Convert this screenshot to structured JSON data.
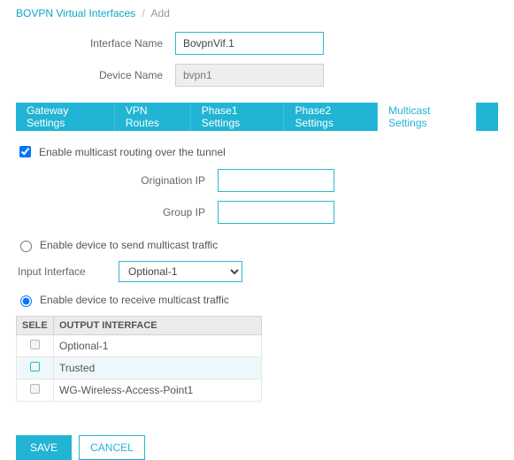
{
  "breadcrumb": {
    "root": "BOVPN Virtual Interfaces",
    "leaf": "Add"
  },
  "fields": {
    "interface_name_label": "Interface Name",
    "interface_name_value": "BovpnVif.1",
    "device_name_label": "Device Name",
    "device_name_value": "bvpn1"
  },
  "tabs": {
    "gateway": "Gateway Settings",
    "vpn_routes": "VPN Routes",
    "phase1": "Phase1 Settings",
    "phase2": "Phase2 Settings",
    "multicast": "Multicast Settings"
  },
  "multicast": {
    "enable_label": "Enable multicast routing over the tunnel",
    "enable_checked": true,
    "origination_ip_label": "Origination IP",
    "origination_ip_value": "",
    "group_ip_label": "Group IP",
    "group_ip_value": "",
    "send_label": "Enable device to send multicast traffic",
    "input_interface_label": "Input Interface",
    "input_interface_value": "Optional-1",
    "receive_label": "Enable device to receive multicast traffic",
    "table_headers": {
      "select": "SELE",
      "output": "OUTPUT INTERFACE"
    },
    "output_interfaces": [
      {
        "name": "Optional-1",
        "highlight": false
      },
      {
        "name": "Trusted",
        "highlight": true
      },
      {
        "name": "WG-Wireless-Access-Point1",
        "highlight": false
      }
    ]
  },
  "buttons": {
    "save": "SAVE",
    "cancel": "CANCEL"
  }
}
